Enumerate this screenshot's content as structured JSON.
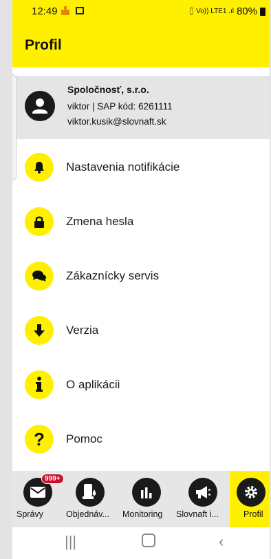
{
  "status_bar": {
    "time": "12:49",
    "signal_text": "Vo)) LTE1 .ıl",
    "battery": "80%"
  },
  "app_bar": {
    "title": "Profil"
  },
  "profile": {
    "company": "Spoločnosť, s.r.o.",
    "user_line": "viktor  | SAP kód: 6261111",
    "email": "viktor.kusik@slovnaft.sk"
  },
  "menu": [
    {
      "label": "Nastavenia notifikácie",
      "icon": "bell-icon"
    },
    {
      "label": "Zmena hesla",
      "icon": "lock-icon"
    },
    {
      "label": "Zákaznícky servis",
      "icon": "chat-icon"
    },
    {
      "label": "Verzia",
      "icon": "arrow-down-icon"
    },
    {
      "label": "O aplikácii",
      "icon": "info-icon"
    },
    {
      "label": "Pomoc",
      "icon": "question-icon"
    }
  ],
  "bottom_nav": {
    "badge": "999+",
    "items": [
      {
        "label": "Správy",
        "icon": "mail-icon"
      },
      {
        "label": "Objednáv...",
        "icon": "fuel-drop-icon"
      },
      {
        "label": "Monitoring",
        "icon": "bar-chart-icon"
      },
      {
        "label": "Slovnaft i...",
        "icon": "megaphone-icon"
      },
      {
        "label": "Profil",
        "icon": "gear-icon"
      }
    ],
    "active_index": 4
  },
  "colors": {
    "accent": "#fff000",
    "dark": "#1a1a1a",
    "badge": "#c8102e",
    "header_bg": "#e5e5e5"
  }
}
